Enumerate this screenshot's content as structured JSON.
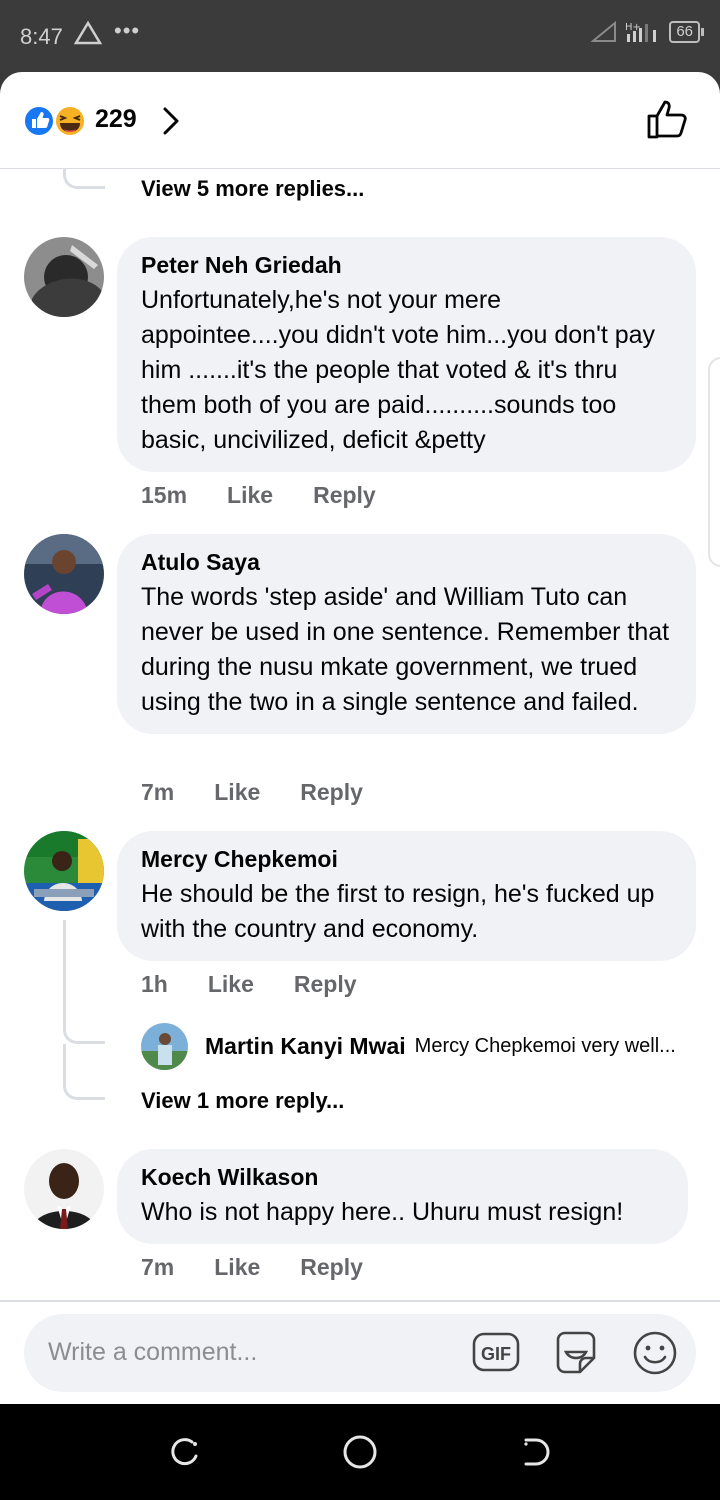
{
  "status_bar": {
    "time": "8:47",
    "dots": "•••",
    "network": "H+",
    "battery": "66"
  },
  "header": {
    "reaction_count": "229"
  },
  "thread_top": {
    "view_more": "View 5 more replies..."
  },
  "comments": [
    {
      "author": "Peter Neh Griedah",
      "text": "Unfortunately,he's not your mere appointee....you didn't vote him...you don't pay him .......it's the people that voted & it's thru them both of you are paid..........sounds too basic, uncivilized, deficit &petty",
      "age": "15m",
      "like": "Like",
      "reply": "Reply"
    },
    {
      "author": "Atulo Saya",
      "text": "The words 'step aside' and William Tuto can never be used in one sentence.  Remember that during the nusu mkate government,  we trued using the two in a single sentence and failed.",
      "age": "7m",
      "like": "Like",
      "reply": "Reply"
    },
    {
      "author": "Mercy Chepkemoi",
      "text": "He should be the first to resign, he's fucked up with the country and economy.",
      "age": "1h",
      "like": "Like",
      "reply": "Reply",
      "reply_preview": {
        "author": "Martin Kanyi Mwai",
        "text": "Mercy Chepkemoi very well..."
      },
      "view_more": "View 1 more reply..."
    },
    {
      "author": "Koech Wilkason",
      "text": "Who is not happy here.. Uhuru must resign!",
      "age": "7m",
      "like": "Like",
      "reply": "Reply"
    }
  ],
  "composer": {
    "placeholder": "Write a comment..."
  },
  "colors": {
    "like_blue": "#1877f2",
    "haha_yellow": "#f7b125",
    "bubble_bg": "#f0f2f5",
    "meta_gray": "#65676b"
  },
  "icons": [
    "warning-icon",
    "like-reaction-icon",
    "haha-reaction-icon",
    "chevron-right-icon",
    "thumbs-up-icon",
    "gif-icon",
    "sticker-icon",
    "emoji-icon",
    "recent-apps-icon",
    "home-icon",
    "back-icon"
  ]
}
